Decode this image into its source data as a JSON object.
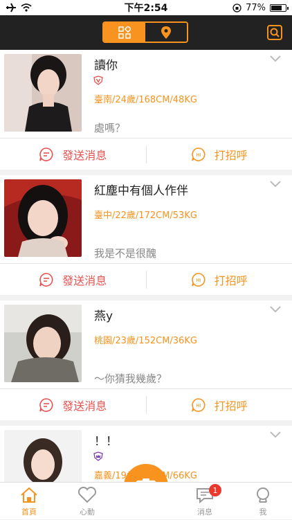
{
  "status_bar": {
    "time": "下午2:54",
    "battery_percent": "77%",
    "battery_level": 0.77
  },
  "header": {
    "segments": [
      "grid-icon",
      "location-pin-icon"
    ],
    "active_segment": 0,
    "search_icon": "search-icon"
  },
  "colors": {
    "accent": "#f7931e",
    "message_red": "#e8514f",
    "badge_red": "#e8392f",
    "header_bg": "#222222"
  },
  "profiles": [
    {
      "name": "讀你",
      "badge": "v-shield",
      "stats": "臺南/24歲/168CM/48KG",
      "quote": "處嗎？"
    },
    {
      "name": "紅塵中有個人作伴",
      "badge": "",
      "stats": "臺中/22歲/172CM/53KG",
      "quote": "我是不是很醜"
    },
    {
      "name": "燕y",
      "badge": "",
      "stats": "桃園/23歲/152CM/36KG",
      "quote": "～你猜我幾歲？"
    },
    {
      "name": "！！",
      "badge": "crown-shield",
      "stats": "嘉義/19歲/191CM/66KG",
      "quote": ""
    }
  ],
  "actions": {
    "send_message": "發送消息",
    "say_hi": "打招呼"
  },
  "tabs": [
    {
      "label": "首頁",
      "icon": "home-icon",
      "active": true
    },
    {
      "label": "心動",
      "icon": "heart-icon",
      "active": false
    },
    {
      "label": "",
      "icon": "camera-icon",
      "active": false
    },
    {
      "label": "消息",
      "icon": "message-icon",
      "active": false,
      "badge": "1"
    },
    {
      "label": "我",
      "icon": "profile-icon",
      "active": false
    }
  ]
}
